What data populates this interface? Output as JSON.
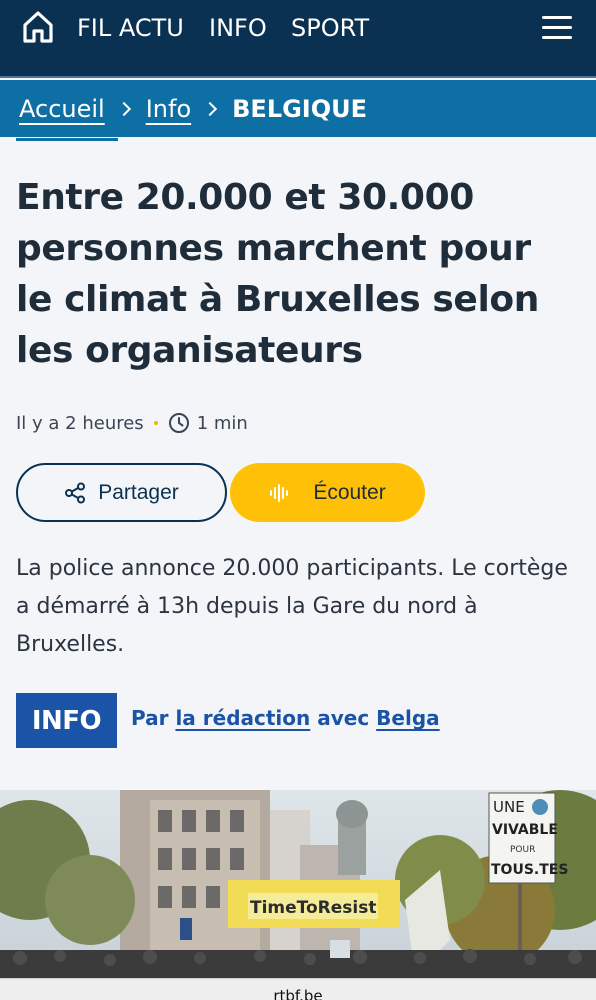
{
  "header": {
    "nav": [
      "FIL ACTU",
      "INFO",
      "SPORT"
    ],
    "home_icon": "home-icon",
    "menu_icon": "hamburger-menu-icon",
    "colors": {
      "background": "#0a3152",
      "text": "#ffffff"
    }
  },
  "breadcrumb": {
    "items": [
      "Accueil",
      "Info"
    ],
    "current": "BELGIQUE",
    "colors": {
      "background": "#0d6fa3"
    }
  },
  "article": {
    "title": "Entre 20.000 et 30.000 personnes marchent pour le climat à Bruxelles selon les organisateurs",
    "published": "Il y a 2 heures",
    "read_time": "1 min",
    "share_label": "Partager",
    "listen_label": "Écouter",
    "lead": "La police annonce 20.000 participants. Le cortège a démarré à 13h depuis la Gare du nord à Bruxelles.",
    "badge": "INFO",
    "byline": {
      "prefix": "Par",
      "author": "la rédaction",
      "connector": "avec",
      "agency": "Belga"
    },
    "photo_signs": {
      "banner": "TimeToResist",
      "placard": [
        "UNE",
        "VIVABLE",
        "POUR",
        "TOUS.TES"
      ]
    },
    "colors": {
      "accent": "#ffc107",
      "badge": "#1b54a6",
      "title": "#1f2d3a"
    }
  },
  "browser": {
    "url": "rtbf.be"
  }
}
